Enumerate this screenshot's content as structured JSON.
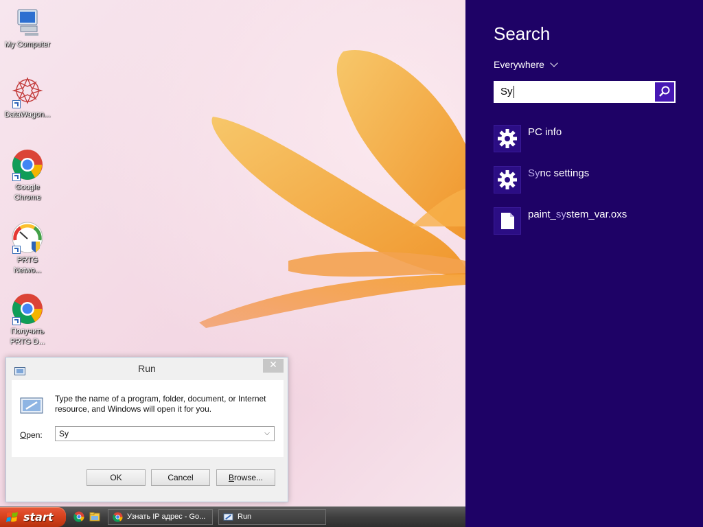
{
  "desktop": {
    "icons": [
      {
        "label": "My Computer"
      },
      {
        "label": "DataWagon..."
      },
      {
        "label": "Google\nChrome"
      },
      {
        "label": "PRTG\nNetwo..."
      },
      {
        "label": "Получить\nPRTG D..."
      }
    ]
  },
  "run_dialog": {
    "title": "Run",
    "close_glyph": "✕",
    "description": "Type the name of a program, folder, document, or Internet resource, and Windows will open it for you.",
    "open_label_prefix": "",
    "open_label_accel": "O",
    "open_label_rest": "pen:",
    "open_value": "Sy",
    "ok_label": "OK",
    "cancel_label": "Cancel",
    "browse_label_accel": "B",
    "browse_label_rest": "rowse..."
  },
  "taskbar": {
    "start_label": "start",
    "tasks": [
      {
        "label": "Узнать IP адрес - Go...",
        "icon": "chrome-icon"
      },
      {
        "label": "Run",
        "icon": "run-icon"
      }
    ]
  },
  "search_charm": {
    "title": "Search",
    "scope": "Everywhere",
    "query": "Sy",
    "results": [
      {
        "prefix": "",
        "match": "",
        "rest": "PC info",
        "icon": "gear-icon"
      },
      {
        "prefix": "",
        "match": "Sy",
        "rest": "nc settings",
        "icon": "gear-icon"
      },
      {
        "prefix": "paint_",
        "match": "sy",
        "rest": "stem_var.oxs",
        "icon": "document-icon"
      }
    ],
    "colors": {
      "background": "#1e0266",
      "tile": "#2b0d84",
      "search_button": "#4617b4"
    }
  }
}
